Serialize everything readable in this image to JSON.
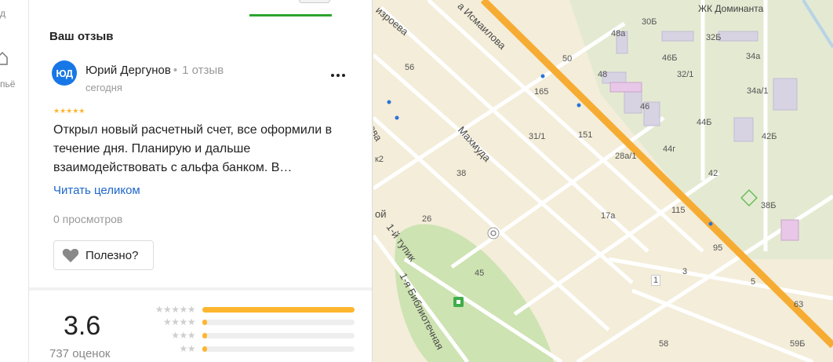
{
  "nav": {
    "top_text": "д",
    "bottom_text": "пьё"
  },
  "panel": {
    "section_title": "Ваш отзыв",
    "review": {
      "avatar_initials": "ЮД",
      "author": "Юрий Дергунов",
      "author_reviews": "1 отзыв",
      "date": "сегодня",
      "stars": "★★★★★",
      "text": "Открыл новый расчетный счет, все оформили в течение дня. Планирую и дальше взаимодействовать с альфа банком. В…",
      "read_more": "Читать целиком",
      "views": "0 просмотров",
      "useful_label": "Полезно?"
    },
    "rating": {
      "value": "3.6",
      "count": "737 оценок",
      "distribution": [
        {
          "stars": "★★★★★",
          "fraction": 1.0
        },
        {
          "stars": "★★★★",
          "fraction": 0.03
        },
        {
          "stars": "★★★",
          "fraction": 0.03
        },
        {
          "stars": "★★",
          "fraction": 0.03
        }
      ]
    }
  },
  "map": {
    "poi": "ЖК Доминанта",
    "streets": [
      {
        "id": "ismailova",
        "text": "а Исмаилова"
      },
      {
        "id": "mahmuda",
        "text": "Махмуда"
      },
      {
        "id": "tupik",
        "text": "1-й тупик"
      },
      {
        "id": "bibliotechnaya",
        "text": "1-я Библиотечная"
      },
      {
        "id": "izrova",
        "text": "изроева"
      },
      {
        "id": "ova",
        "text": "рова"
      },
      {
        "id": "ka",
        "text": "к2"
      },
      {
        "id": "oj",
        "text": "ой"
      }
    ],
    "house_numbers": [
      "30Б",
      "48а",
      "46Б",
      "32Б",
      "34а",
      "50",
      "48",
      "32/1",
      "34а/1",
      "46",
      "165",
      "44Б",
      "42Б",
      "56",
      "31/1",
      "151",
      "44г",
      "28а/1",
      "42",
      "38",
      "38Б",
      "17а",
      "115",
      "26",
      "95",
      "45",
      "3",
      "1",
      "5",
      "63",
      "58",
      "59Б"
    ],
    "colors": {
      "main_road": "#f6ac33",
      "grass": "#cde3b2",
      "road": "#ffffff",
      "block": "#f6efdc"
    }
  }
}
